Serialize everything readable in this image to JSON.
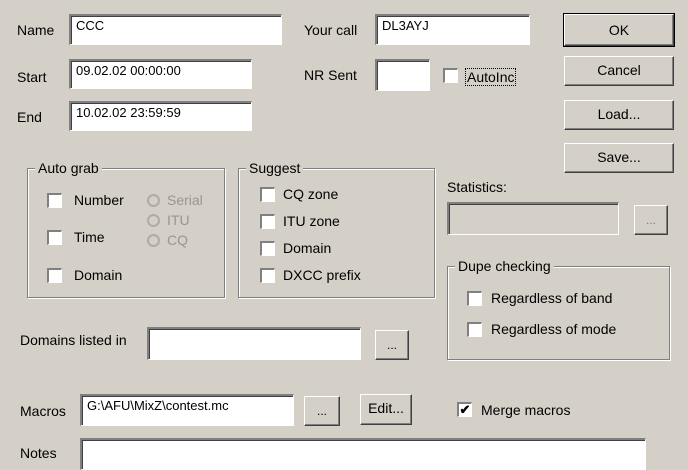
{
  "fields": {
    "name": {
      "label": "Name",
      "value": "CCC"
    },
    "your_call": {
      "label": "Your call",
      "value": "DL3AYJ"
    },
    "start": {
      "label": "Start",
      "value": "09.02.02 00:00:00"
    },
    "nr_sent": {
      "label": "NR Sent",
      "value": ""
    },
    "end": {
      "label": "End",
      "value": "10.02.02 23:59:59"
    }
  },
  "autoinc": {
    "label": "AutoInc",
    "checked": false
  },
  "buttons": {
    "ok": "OK",
    "cancel": "Cancel",
    "load": "Load...",
    "save": "Save...",
    "statistics_browse": "...",
    "domains_browse": "...",
    "macros_browse": "...",
    "edit": "Edit..."
  },
  "auto_grab": {
    "title": "Auto grab",
    "number": {
      "label": "Number",
      "checked": false
    },
    "time": {
      "label": "Time",
      "checked": false
    },
    "domain": {
      "label": "Domain",
      "checked": false
    },
    "serial": {
      "label": "Serial"
    },
    "itu": {
      "label": "ITU"
    },
    "cq": {
      "label": "CQ"
    }
  },
  "suggest": {
    "title": "Suggest",
    "items": [
      {
        "label": "CQ zone",
        "checked": false
      },
      {
        "label": "ITU zone",
        "checked": false
      },
      {
        "label": "Domain",
        "checked": false
      },
      {
        "label": "DXCC prefix",
        "checked": false
      }
    ]
  },
  "statistics": {
    "label": "Statistics:",
    "value": ""
  },
  "dupe_checking": {
    "title": "Dupe checking",
    "regardless_band": {
      "label": "Regardless of band",
      "checked": false
    },
    "regardless_mode": {
      "label": "Regardless of mode",
      "checked": false
    }
  },
  "domains": {
    "label": "Domains listed in",
    "value": ""
  },
  "macros": {
    "label": "Macros",
    "value": "G:\\AFU\\MixZ\\contest.mc"
  },
  "merge_macros": {
    "label": "Merge macros",
    "checked": true,
    "mark": "✔"
  },
  "notes": {
    "label": "Notes",
    "value": ""
  }
}
